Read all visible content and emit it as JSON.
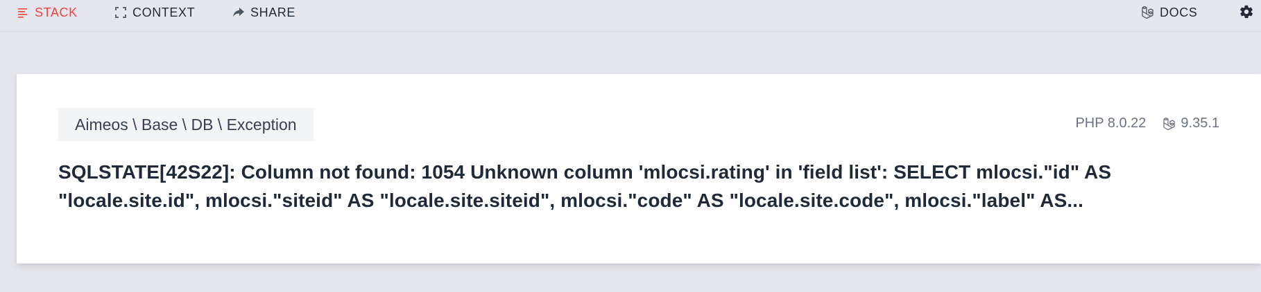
{
  "nav": {
    "stack_label": "STACK",
    "context_label": "CONTEXT",
    "share_label": "SHARE",
    "docs_label": "DOCS"
  },
  "exception": {
    "class_name": "Aimeos \\ Base \\ DB \\ Exception",
    "php_version": "PHP 8.0.22",
    "laravel_version": "9.35.1",
    "message": "SQLSTATE[42S22]: Column not found: 1054 Unknown column 'mlocsi.rating' in 'field list': SELECT mlocsi.\"id\" AS \"locale.site.id\", mlocsi.\"siteid\" AS \"locale.site.siteid\", mlocsi.\"code\" AS \"locale.site.code\", mlocsi.\"label\" AS..."
  },
  "icons": {
    "stack": "list-icon",
    "context": "expand-icon",
    "share": "share-arrow-icon",
    "docs": "laravel-icon",
    "settings": "gear-icon"
  },
  "colors": {
    "active": "#ef4444",
    "background": "#e6e7ec",
    "card": "#ffffff",
    "badge": "#f3f4f6",
    "muted": "#6b7280"
  }
}
